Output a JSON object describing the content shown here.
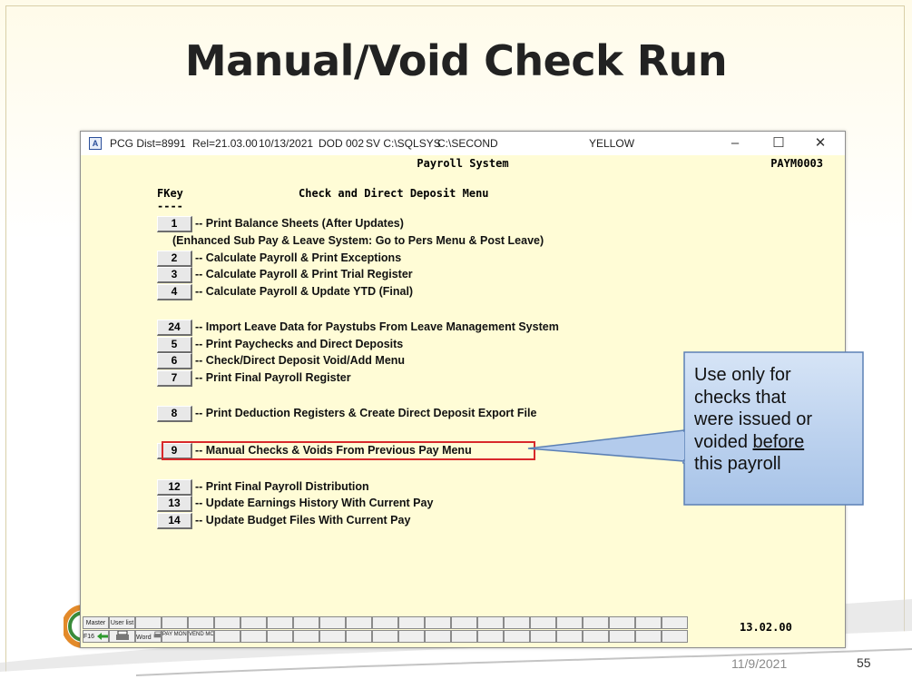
{
  "slide": {
    "title": "Manual/Void Check Run",
    "footer_date": "11/9/2021",
    "page_number": "55"
  },
  "window": {
    "icon_label": "A",
    "title_parts": {
      "dist": "PCG Dist=8991",
      "rel": "Rel=21.03.00",
      "date": "10/13/2021",
      "dod": "DOD 002",
      "sv": "SV C:\\SQLSYS",
      "path": "C:\\SECOND",
      "color": "YELLOW"
    },
    "controls": {
      "minimize": "–",
      "maximize": "☐",
      "close": "✕"
    },
    "system_title": "Payroll System",
    "screen_id": "PAYM0003",
    "fkey_header": "FKey",
    "fkey_dashes": "----",
    "menu_title": "Check and Direct Deposit Menu",
    "items": [
      {
        "key": "1",
        "text": "-- Print Balance Sheets (After Updates)"
      },
      {
        "key": "",
        "text": "(Enhanced Sub Pay & Leave System:  Go to Pers Menu & Post Leave)"
      },
      {
        "key": "2",
        "text": "-- Calculate Payroll & Print Exceptions"
      },
      {
        "key": "3",
        "text": "-- Calculate Payroll & Print Trial Register"
      },
      {
        "key": "4",
        "text": "-- Calculate Payroll & Update YTD (Final)"
      },
      {
        "key": "24",
        "text": "-- Import Leave Data for Paystubs From Leave Management System"
      },
      {
        "key": "5",
        "text": "-- Print Paychecks and Direct Deposits"
      },
      {
        "key": "6",
        "text": "-- Check/Direct Deposit  Void/Add Menu"
      },
      {
        "key": "7",
        "text": "-- Print Final Payroll Register"
      },
      {
        "key": "8",
        "text": "-- Print Deduction Registers & Create Direct Deposit Export File"
      },
      {
        "key": "9",
        "text": "-- Manual Checks & Voids From Previous Pay Menu"
      },
      {
        "key": "12",
        "text": "-- Print Final Payroll Distribution"
      },
      {
        "key": "13",
        "text": "-- Update Earnings History With Current Pay"
      },
      {
        "key": "14",
        "text": "-- Update Budget Files With Current Pay"
      }
    ],
    "version": "13.02.00",
    "fbar": {
      "master": "Master",
      "user_list": "User list",
      "f16": "F16",
      "pay_monitor": "PAY MONITOR",
      "vend_monitor": "VEND MONITOR",
      "word": "Word"
    }
  },
  "callout": {
    "line1": "Use only for",
    "line2": "checks that",
    "line3": "were issued or",
    "line4_pre": "voided ",
    "line4_u": "before",
    "line5": "this payroll"
  },
  "colors": {
    "screen_bg": "#fffcd6",
    "highlight": "#d8282a",
    "callout_fill": "#bcd3ef"
  }
}
